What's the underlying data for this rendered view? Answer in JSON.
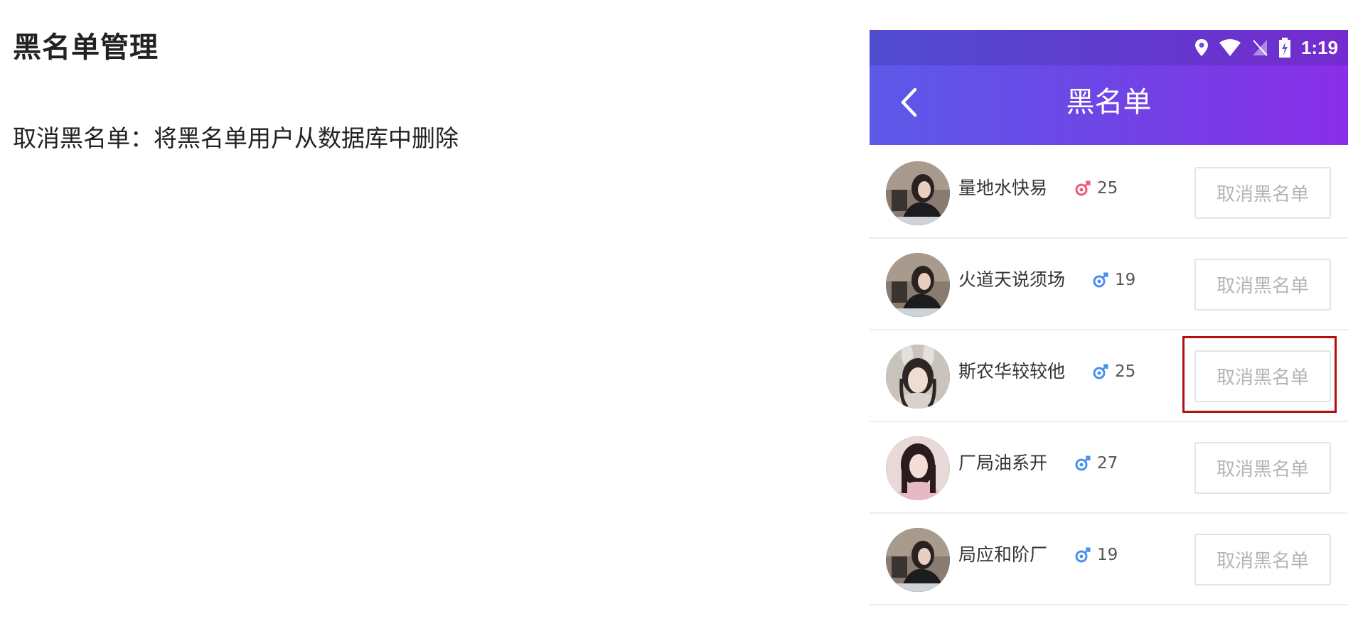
{
  "doc": {
    "title": "黑名单管理",
    "description": "取消黑名单：将黑名单用户从数据库中删除"
  },
  "status_bar": {
    "time": "1:19",
    "icons": [
      "location-icon",
      "wifi-icon",
      "no-sim-icon",
      "battery-charging-icon"
    ]
  },
  "nav": {
    "back_icon": "chevron-left-icon",
    "title": "黑名单"
  },
  "colors": {
    "header_gradient_start": "#5c59e8",
    "header_gradient_end": "#8b2ee8",
    "female_icon": "#f05a7a",
    "male_icon": "#4a8ff0",
    "button_text": "#b4b4b4",
    "highlight": "#b01010"
  },
  "users": [
    {
      "name": "量地水快易",
      "gender": "female",
      "age": "25",
      "button_label": "取消黑名单",
      "avatar": "dark-hair-woman-photo"
    },
    {
      "name": "火道天说须场",
      "gender": "male",
      "age": "19",
      "button_label": "取消黑名单",
      "avatar": "dark-hair-woman-photo"
    },
    {
      "name": "斯农华较较他",
      "gender": "male",
      "age": "25",
      "button_label": "取消黑名单",
      "avatar": "bunny-ears-woman-photo"
    },
    {
      "name": "厂局油系开",
      "gender": "male",
      "age": "27",
      "button_label": "取消黑名单",
      "avatar": "pink-outfit-woman-photo"
    },
    {
      "name": "局应和阶厂",
      "gender": "male",
      "age": "19",
      "button_label": "取消黑名单",
      "avatar": "dark-hair-woman-photo"
    }
  ],
  "annotation": {
    "highlighted_row_index": 2
  }
}
